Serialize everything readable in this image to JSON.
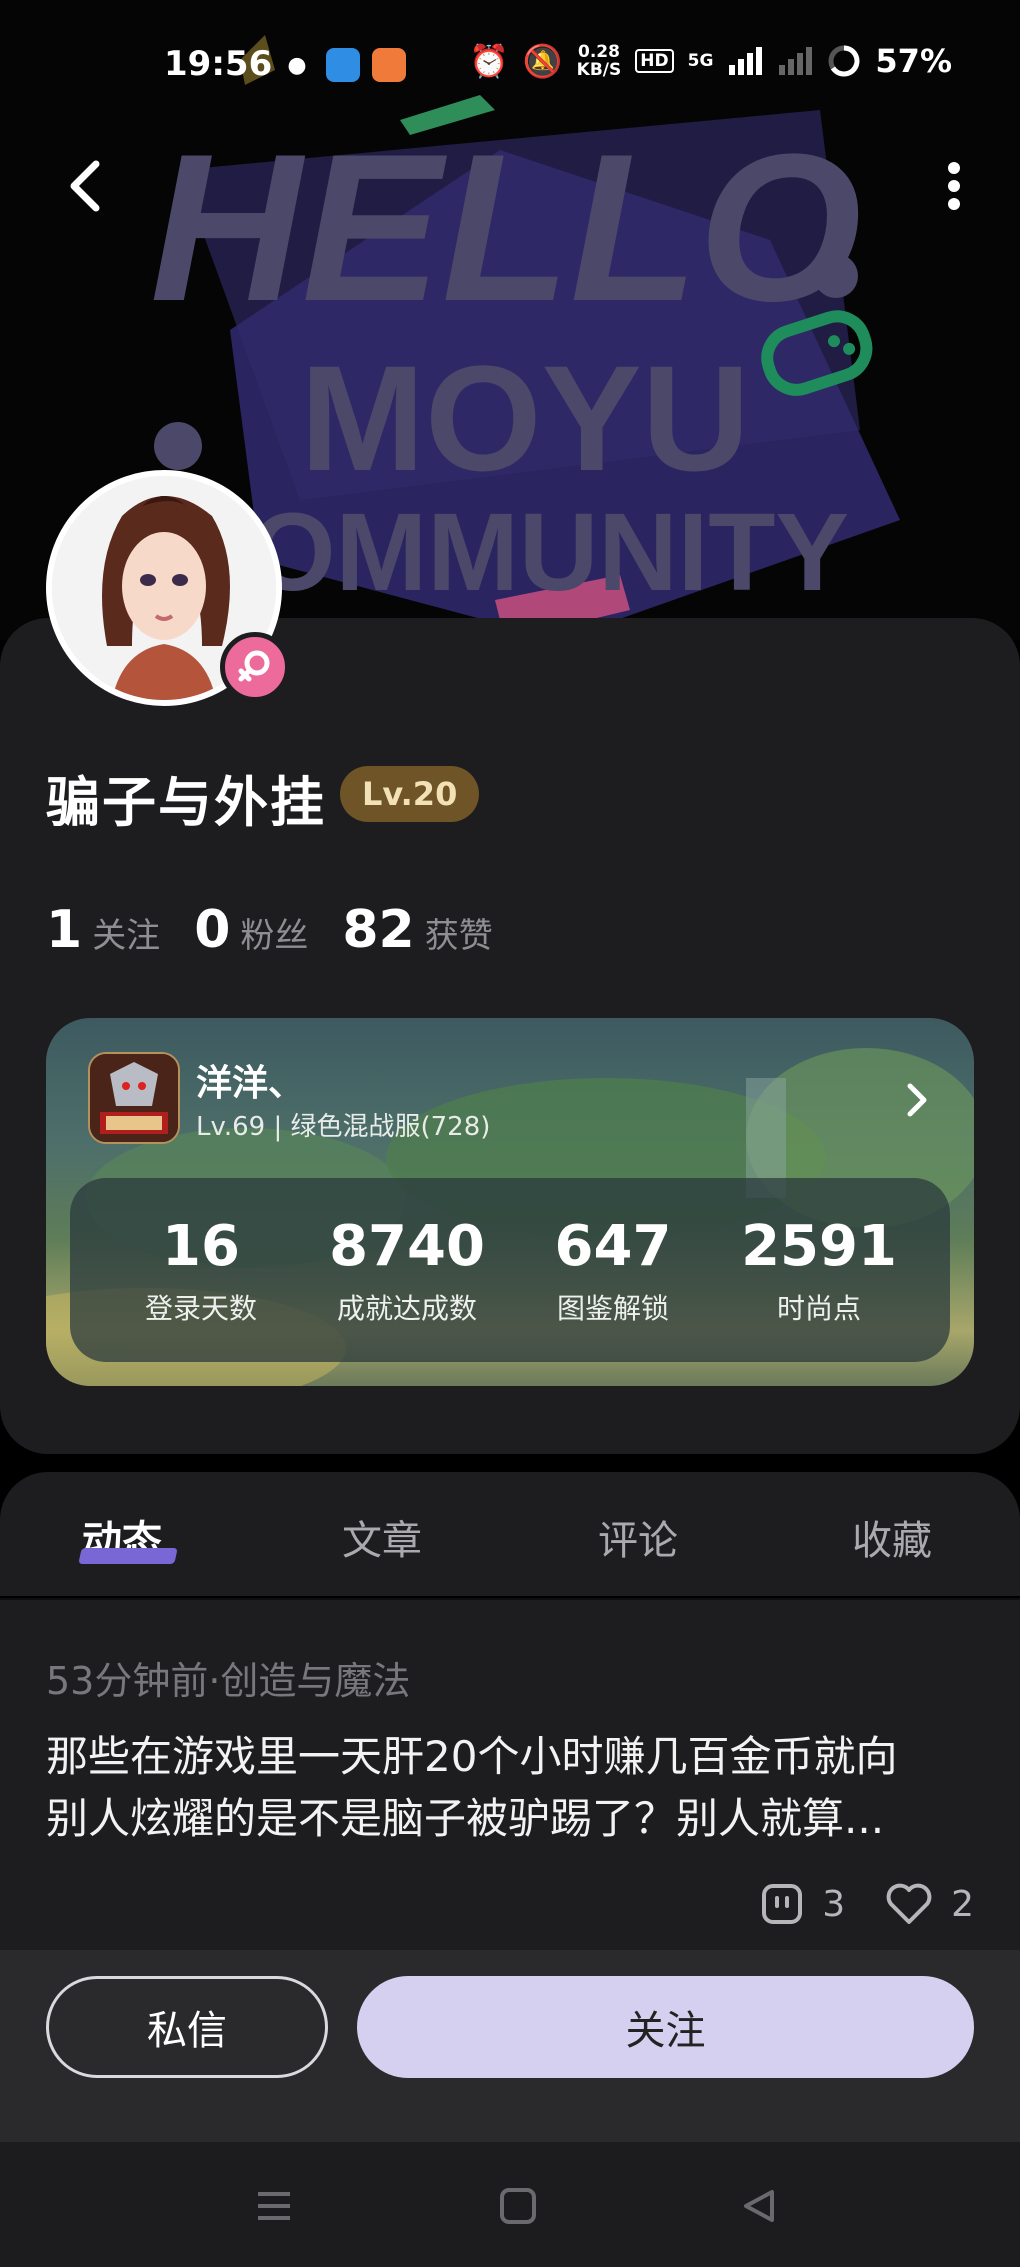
{
  "status_bar": {
    "time": "19:56",
    "net_speed_value": "0.28",
    "net_speed_unit": "KB/S",
    "hd_label": "HD",
    "network_label": "5G",
    "battery": "57%"
  },
  "banner": {
    "line1": "HELLO",
    "line2": "MOYU",
    "line3": "OMMUNITY"
  },
  "profile": {
    "username": "骗子与外挂",
    "level": "Lv.20",
    "stats": [
      {
        "num": "1",
        "label": "关注"
      },
      {
        "num": "0",
        "label": "粉丝"
      },
      {
        "num": "82",
        "label": "获赞"
      }
    ]
  },
  "game_card": {
    "name": "洋洋、",
    "subtitle": "Lv.69 | 绿色混战服(728)",
    "stats": [
      {
        "num": "16",
        "label": "登录天数"
      },
      {
        "num": "8740",
        "label": "成就达成数"
      },
      {
        "num": "647",
        "label": "图鉴解锁"
      },
      {
        "num": "2591",
        "label": "时尚点"
      }
    ]
  },
  "tabs": [
    {
      "label": "动态",
      "active": true
    },
    {
      "label": "文章",
      "active": false
    },
    {
      "label": "评论",
      "active": false
    },
    {
      "label": "收藏",
      "active": false
    }
  ],
  "post": {
    "meta": "53分钟前·创造与魔法",
    "line1": "那些在游戏里一天肝20个小时赚几百金币就向",
    "line2": "别人炫耀的是不是脑子被驴踢了？别人就算...",
    "comments": "3",
    "likes": "2"
  },
  "actions": {
    "message_label": "私信",
    "follow_label": "关注"
  },
  "colors": {
    "accent": "#7a67d6",
    "follow_button": "#d5cff0",
    "level_badge": "#6e5426",
    "gender_badge": "#ec6b9b",
    "background": "#1d1d1f"
  }
}
